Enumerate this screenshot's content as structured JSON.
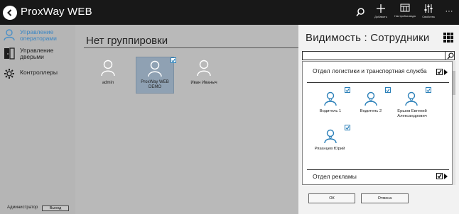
{
  "app": {
    "title": "ProxWay WEB"
  },
  "toolbar": {
    "search_label": "",
    "add_label": "Добавить",
    "view_label": "Настройка вида",
    "props_label": "Свойства",
    "more_label": "···"
  },
  "sidebar": {
    "items": [
      {
        "label": "Управление операторами",
        "active": true
      },
      {
        "label": "Управление дверьми",
        "active": false
      },
      {
        "label": "Контроллеры",
        "active": false
      }
    ]
  },
  "footer": {
    "user": "Администратор",
    "logout": "Выход"
  },
  "main": {
    "group_title": "Нет группировки",
    "operators": [
      {
        "name": "admin",
        "selected": false
      },
      {
        "name": "ProxWay WEB DEMO",
        "selected": true
      },
      {
        "name": "Иван Иваныч",
        "selected": false
      }
    ]
  },
  "panel": {
    "title": "Видимость : Сотрудники",
    "search_placeholder": "",
    "departments": [
      {
        "name": "Отдел логистики и транспортная служба",
        "checked": true,
        "employees": [
          {
            "name": "Водитель 1",
            "checked": true
          },
          {
            "name": "Водитель 2",
            "checked": true
          },
          {
            "name": "Ершов Евгений Александрович",
            "checked": true
          },
          {
            "name": "Рязанцев Юрий",
            "checked": true
          }
        ]
      },
      {
        "name": "Отдел рекламы",
        "checked": true,
        "employees": []
      }
    ],
    "ok": "ОК",
    "cancel": "Отмена"
  },
  "colors": {
    "accent": "#2a7fb8",
    "topbar": "#181818",
    "selected_card": "#8fa1b3"
  }
}
